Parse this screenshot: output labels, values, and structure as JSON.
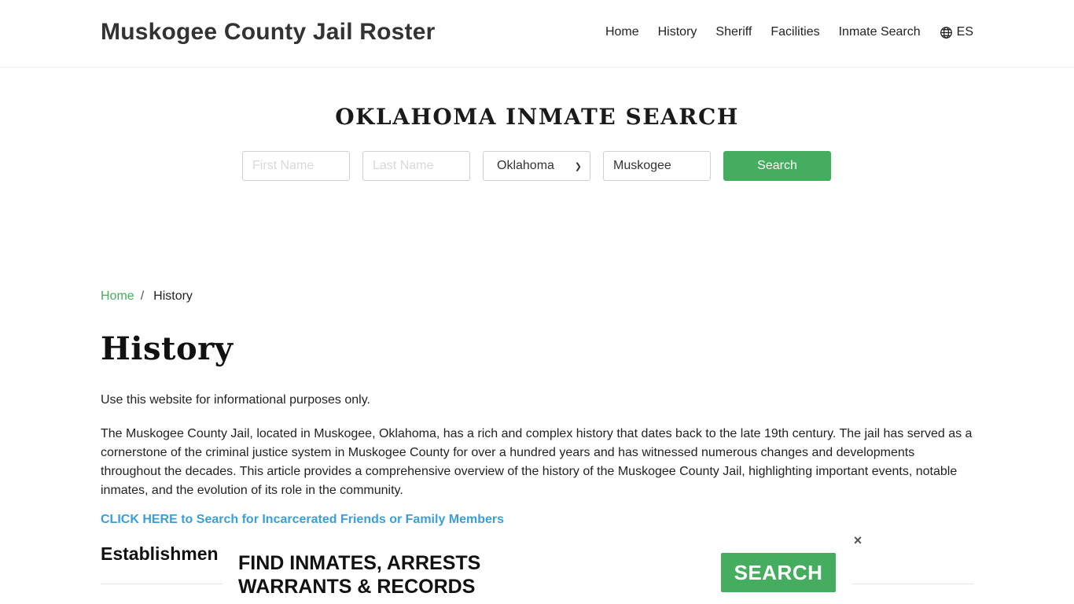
{
  "header": {
    "site_title": "Muskogee County Jail Roster",
    "nav": [
      {
        "label": "Home"
      },
      {
        "label": "History"
      },
      {
        "label": "Sheriff"
      },
      {
        "label": "Facilities"
      },
      {
        "label": "Inmate Search"
      }
    ],
    "language": {
      "label": "ES",
      "icon": "globe-icon"
    }
  },
  "search": {
    "title": "OKLAHOMA INMATE SEARCH",
    "first_name_placeholder": "First Name",
    "last_name_placeholder": "Last Name",
    "state_selected": "Oklahoma",
    "county_value": "Muskogee",
    "button_label": "Search"
  },
  "breadcrumb": {
    "home": "Home",
    "separator": "/",
    "current": "History"
  },
  "content": {
    "title": "History",
    "disclaimer": "Use this website for informational purposes only.",
    "intro": "The Muskogee County Jail, located in Muskogee, Oklahoma, has a rich and complex history that dates back to the late 19th century. The jail has served as a cornerstone of the criminal justice system in Muskogee County for over a hundred years and has witnessed numerous changes and developments throughout the decades. This article provides a comprehensive overview of the history of the Muskogee County Jail, highlighting important events, notable inmates, and the evolution of its role in the community.",
    "cta_link": "CLICK HERE to Search for Incarcerated Friends or Family Members",
    "section_heading": "Establishmen"
  },
  "ad": {
    "line1": "FIND INMATES, ARRESTS",
    "line2": "WARRANTS & RECORDS",
    "button_label": "SEARCH",
    "close_label": "×"
  },
  "colors": {
    "accent_green": "#45ad5f",
    "link_blue": "#3a9fd6"
  }
}
